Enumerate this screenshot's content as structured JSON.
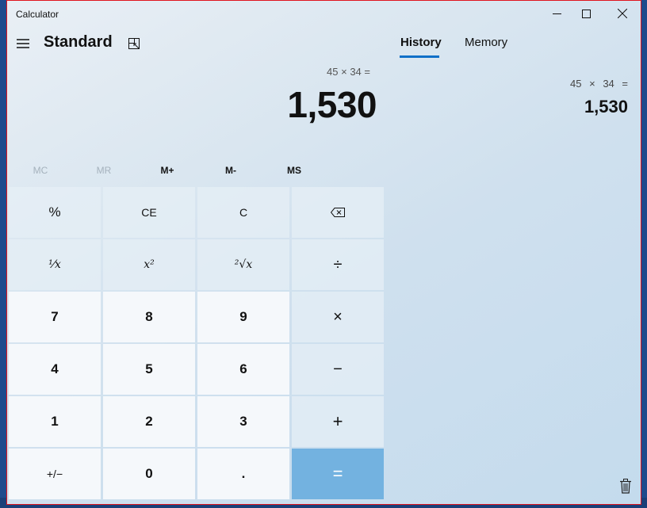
{
  "window": {
    "title": "Calculator"
  },
  "header": {
    "mode": "Standard"
  },
  "display": {
    "expression": "45 × 34 =",
    "result": "1,530"
  },
  "memory": {
    "buttons": [
      "MC",
      "MR",
      "M+",
      "M-",
      "MS"
    ]
  },
  "keypad": {
    "keys": [
      [
        "%",
        "CE",
        "C",
        "⌫"
      ],
      [
        "¹⁄x",
        "x²",
        "²√x",
        "÷"
      ],
      [
        "7",
        "8",
        "9",
        "×"
      ],
      [
        "4",
        "5",
        "6",
        "−"
      ],
      [
        "1",
        "2",
        "3",
        "+"
      ],
      [
        "+/−",
        "0",
        ".",
        "="
      ]
    ]
  },
  "panel": {
    "tabs": [
      "History",
      "Memory"
    ],
    "active_tab": "History",
    "history": [
      {
        "expression": "45 × 34 =",
        "result": "1,530"
      }
    ]
  },
  "colors": {
    "accent": "#1070c8",
    "equals_key": "#73b2e0",
    "window_border": "#e0141e"
  }
}
